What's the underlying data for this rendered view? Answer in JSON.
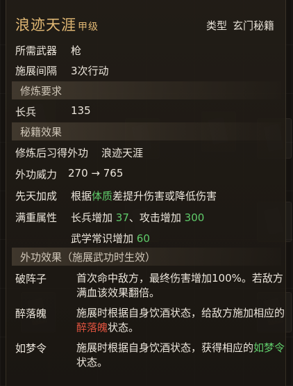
{
  "header": {
    "title": "浪迹天涯",
    "grade": "甲级",
    "type_label": "类型",
    "type_value": "玄门秘籍"
  },
  "basics": [
    {
      "label": "所需武器",
      "value": "枪"
    },
    {
      "label": "施展间隔",
      "value": "3次行动"
    }
  ],
  "requirements": {
    "title": "修炼要求",
    "items": [
      {
        "label": "长兵",
        "value": "135"
      }
    ]
  },
  "effects": {
    "title": "秘籍效果",
    "learned_label": "修炼后习得外功",
    "learned_value": "浪迹天涯",
    "power_label": "外功威力",
    "power_value": "270 → 765",
    "pre_label": "先天加成",
    "pre_text_1": "根据",
    "pre_highlight": "体质",
    "pre_text_2": "差提升伤害或降低伤害",
    "full_label": "满重属性",
    "full_line1_a": "长兵增加 ",
    "full_line1_b": "37",
    "full_line1_c": "、攻击增加 ",
    "full_line1_d": "300",
    "full_line2_a": "武学常识增加 ",
    "full_line2_b": "60"
  },
  "outer": {
    "title": "外功效果（施展武功时生效）",
    "items": [
      {
        "label": "破阵子",
        "text": "首次命中敌方，最终伤害增加100%。若敌方满血该效果翻倍。"
      },
      {
        "label": "醉落魄",
        "text_a": "施展时根据自身饮酒状态，给敌方施加相应的",
        "highlight": "醉落魄",
        "text_b": "状态。"
      },
      {
        "label": "如梦令",
        "text_a": "施展时根据自身饮酒状态，获得相应的",
        "highlight": "如梦令",
        "text_b": "状态。"
      }
    ]
  },
  "colors": {
    "title_gold": "#e1b874",
    "green": "#5fcb6a",
    "red": "#e0533f",
    "text": "#ece6dc"
  }
}
